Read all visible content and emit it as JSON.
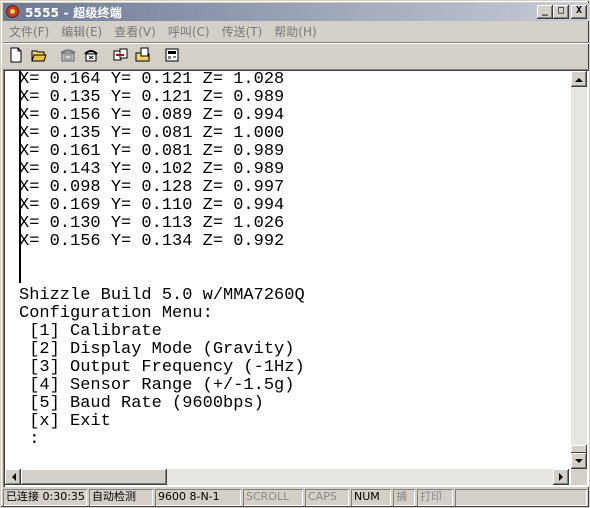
{
  "window": {
    "title": "5555 - 超级终端",
    "minimize_label": "_",
    "maximize_label": "□",
    "close_label": "X"
  },
  "menu": [
    {
      "label": "文件(F)"
    },
    {
      "label": "编辑(E)"
    },
    {
      "label": "查看(V)"
    },
    {
      "label": "呼叫(C)"
    },
    {
      "label": "传送(T)"
    },
    {
      "label": "帮助(H)"
    }
  ],
  "toolbar": [
    {
      "icon": "new-document-icon"
    },
    {
      "icon": "open-folder-icon"
    },
    {
      "icon": "call-phone-icon"
    },
    {
      "icon": "disconnect-phone-icon"
    },
    {
      "icon": "send-icon"
    },
    {
      "icon": "receive-icon"
    },
    {
      "icon": "properties-icon"
    }
  ],
  "terminal": {
    "lines": [
      "X= 0.164 Y= 0.121 Z= 1.028",
      "X= 0.135 Y= 0.121 Z= 0.989",
      "X= 0.156 Y= 0.089 Z= 0.994",
      "X= 0.135 Y= 0.081 Z= 1.000",
      "X= 0.161 Y= 0.081 Z= 0.989",
      "X= 0.143 Y= 0.102 Z= 0.989",
      "X= 0.098 Y= 0.128 Z= 0.997",
      "X= 0.169 Y= 0.110 Z= 0.994",
      "X= 0.130 Y= 0.113 Z= 1.026",
      "X= 0.156 Y= 0.134 Z= 0.992",
      "",
      "",
      "Shizzle Build 5.0 w/MMA7260Q",
      "Configuration Menu:",
      " [1] Calibrate",
      " [2] Display Mode (Gravity)",
      " [3] Output Frequency (-1Hz)",
      " [4] Sensor Range (+/-1.5g)",
      " [5] Baud Rate (9600bps)",
      " [x] Exit",
      " :"
    ]
  },
  "status": {
    "connected": "已连接 0:30:35",
    "detect": "自动检测",
    "params": "9600 8-N-1",
    "scroll": "SCROLL",
    "caps": "CAPS",
    "num": "NUM",
    "capture": "捕",
    "print": "打印"
  }
}
